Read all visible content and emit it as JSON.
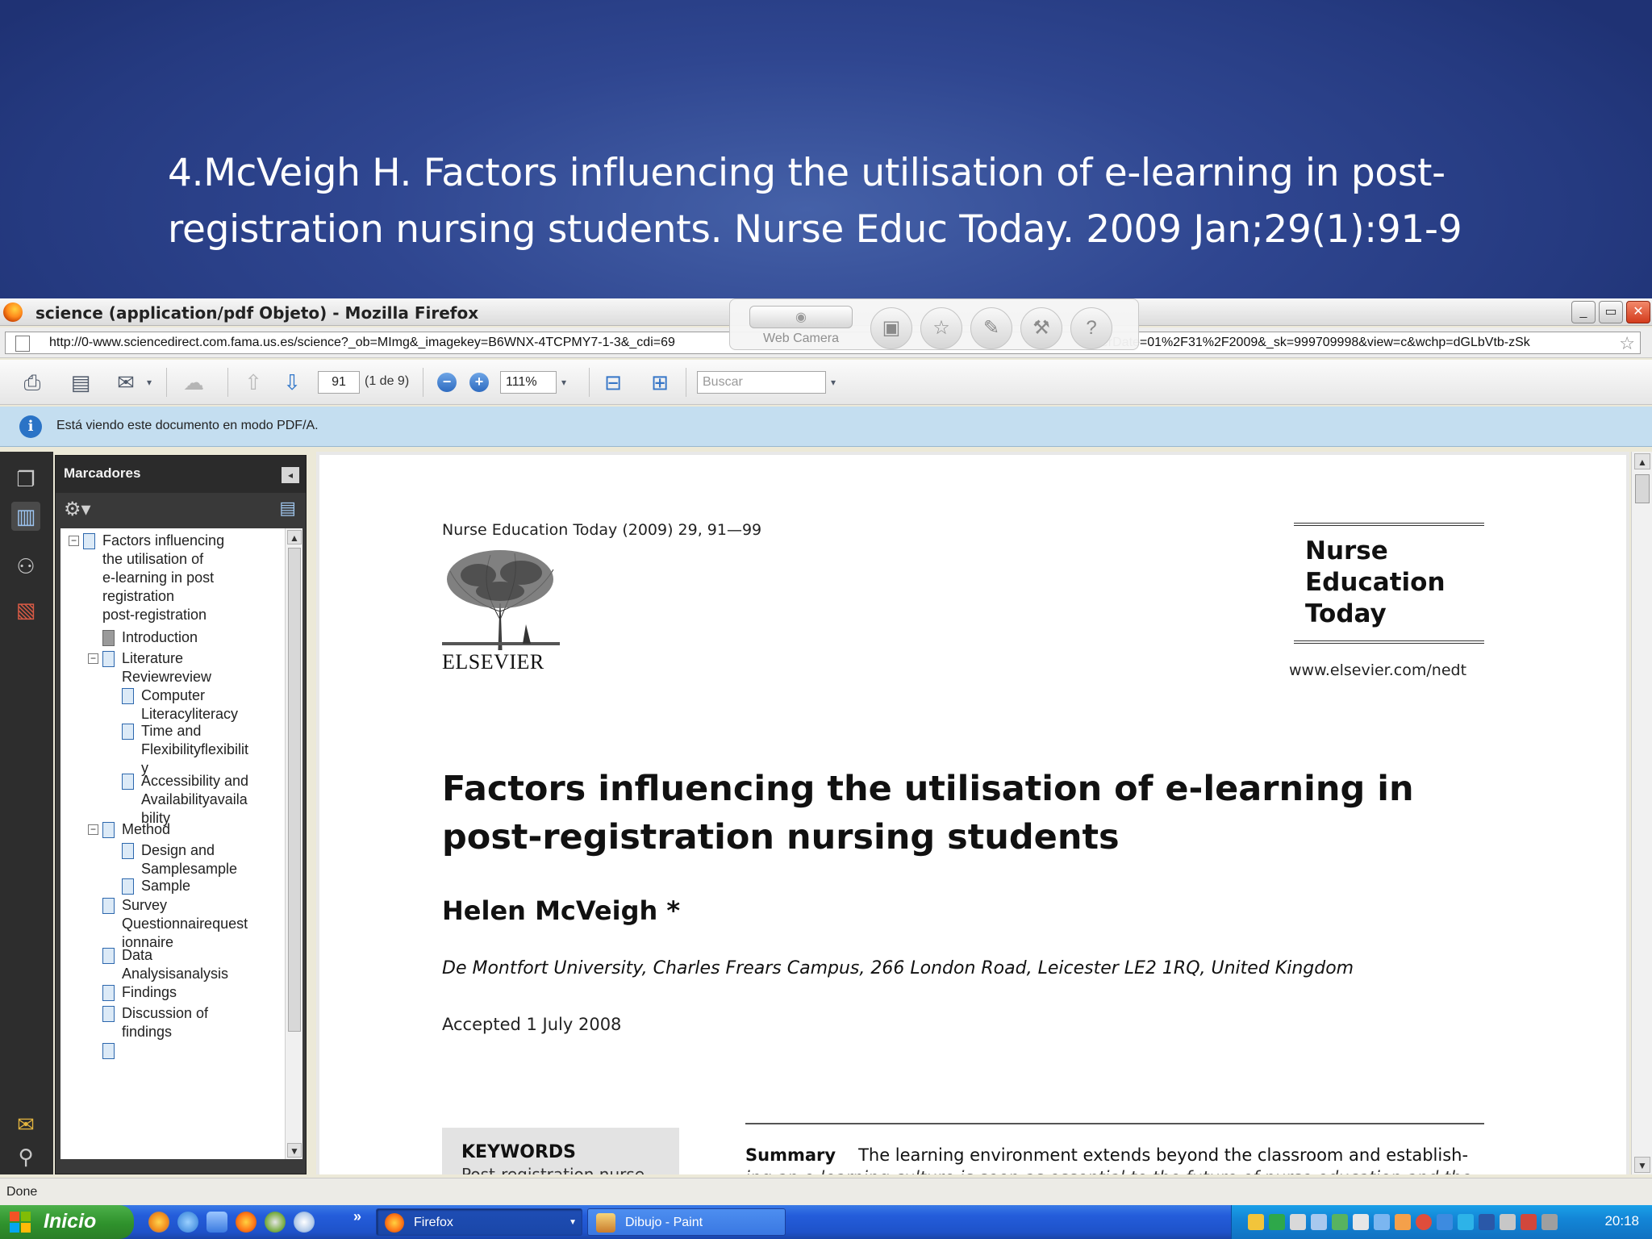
{
  "slide": {
    "title_line1": "4.McVeigh H. Factors influencing the utilisation of e-learning in post-",
    "title_line2": "registration nursing students. Nurse Educ Today. 2009 Jan;29(1):91-9"
  },
  "window": {
    "title": "science (application/pdf Objeto) - Mozilla Firefox",
    "url_left": "http://0-www.sciencedirect.com.fama.us.es/science?_ob=MImg&_imagekey=B6WNX-4TCPMY7-1-3&_cdi=69",
    "url_right": "verDate=01%2F31%2F2009&_sk=999709998&view=c&wchp=dGLbVtb-zSk",
    "buttons": [
      "_",
      "▭",
      "✕"
    ]
  },
  "webcam": {
    "label": "Web Camera",
    "icons": [
      "presentation-icon",
      "star-icon",
      "edit-icon",
      "wrench-icon",
      "help-icon"
    ],
    "help_glyph": "?"
  },
  "toolbar": {
    "page_number": "91",
    "page_count": "(1 de 9)",
    "zoom": "111%",
    "search_placeholder": "Buscar"
  },
  "infobar": {
    "message": "Está viendo este documento en modo PDF/A."
  },
  "bookmarks": {
    "header": "Marcadores",
    "items": [
      {
        "label_lines": [
          "Factors influencing",
          "the utilisation of",
          "e-learning in post",
          "registration",
          "post-registration"
        ]
      },
      {
        "label_lines": [
          "Introduction"
        ]
      },
      {
        "label_lines": [
          "Literature",
          "Reviewreview"
        ]
      },
      {
        "label_lines": [
          "Computer",
          "Literacyliteracy"
        ]
      },
      {
        "label_lines": [
          "Time and",
          "Flexibilityflexibilit",
          "y"
        ]
      },
      {
        "label_lines": [
          "Accessibility and",
          "Availabilityavaila",
          "bility"
        ]
      },
      {
        "label_lines": [
          "Method"
        ]
      },
      {
        "label_lines": [
          "Design and",
          "Samplesample"
        ]
      },
      {
        "label_lines": [
          "Sample"
        ]
      },
      {
        "label_lines": [
          "Survey",
          "Questionnairequest",
          "ionnaire"
        ]
      },
      {
        "label_lines": [
          "Data",
          "Analysisanalysis"
        ]
      },
      {
        "label_lines": [
          "Findings"
        ]
      },
      {
        "label_lines": [
          "Discussion of",
          "findings"
        ]
      }
    ]
  },
  "document": {
    "journal_line": "Nurse Education Today (2009) 29, 91—99",
    "publisher": "ELSEVIER",
    "journal_name_lines": [
      "Nurse",
      "Education",
      "Today"
    ],
    "journal_url": "www.elsevier.com/nedt",
    "title_line1": "Factors influencing the utilisation of e-learning in",
    "title_line2": "post-registration nursing students",
    "author": "Helen McVeigh *",
    "affiliation": "De Montfort University, Charles Frears Campus, 266 London Road, Leicester LE2 1RQ, United Kingdom",
    "accepted": "Accepted 1 July 2008",
    "keywords_heading": "KEYWORDS",
    "keywords_partial": "Post-registration    nurse",
    "summary_label": "Summary",
    "summary_text": "The learning environment extends beyond the classroom and establish-",
    "summary_text2": "ing an e-learning culture is seen as essential to the future of nurse education and the"
  },
  "statusbar": {
    "text": "Done"
  },
  "taskbar": {
    "start": "Inicio",
    "tasks": [
      {
        "label": "Firefox",
        "active": true
      },
      {
        "label": "Dibujo - Paint",
        "active": false
      }
    ],
    "more": "»",
    "clock": "20:18"
  },
  "colors": {
    "slide_bg": "#2c3f86",
    "taskbar": "#245ddb",
    "start": "#2f922c",
    "infobar": "#c4def0"
  }
}
